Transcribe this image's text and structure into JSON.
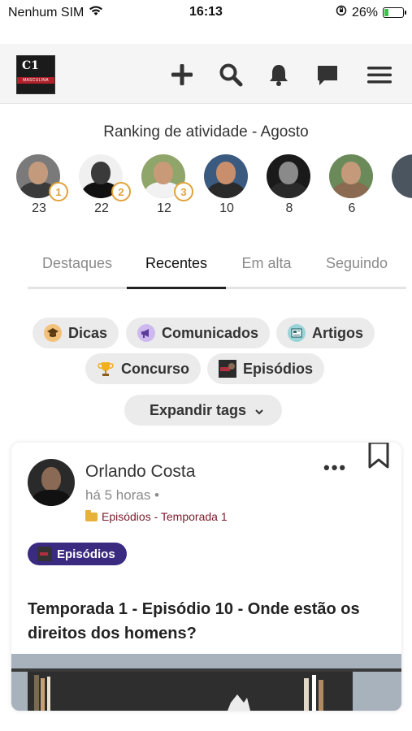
{
  "status_bar": {
    "carrier": "Nenhum SIM",
    "time": "16:13",
    "battery": "26%",
    "battery_level": 0.26
  },
  "app_header": {
    "logo_text": "MASCULINA",
    "icons": [
      "plus-icon",
      "search-icon",
      "bell-icon",
      "chat-icon",
      "menu-icon"
    ]
  },
  "ranking": {
    "title": "Ranking de atividade - Agosto",
    "users": [
      {
        "count": "23",
        "medal": "1",
        "medal_color": "#e0a23a",
        "bg": "#7a7a7a",
        "face": "#c49a7c",
        "body": "#3a3a3a"
      },
      {
        "count": "22",
        "medal": "2",
        "medal_color": "#e0a23a",
        "bg": "#f0f0f0",
        "face": "#3a3a3a",
        "body": "#111111"
      },
      {
        "count": "12",
        "medal": "3",
        "medal_color": "#e0a23a",
        "bg": "#8fa56a",
        "face": "#c89a78",
        "body": "#f2f2f2"
      },
      {
        "count": "10",
        "medal": "",
        "medal_color": "",
        "bg": "#3a5a80",
        "face": "#c98f6c",
        "body": "#2a2a2a"
      },
      {
        "count": "8",
        "medal": "",
        "medal_color": "",
        "bg": "#1a1a1a",
        "face": "#8a8a8a",
        "body": "#2a2a2a"
      },
      {
        "count": "6",
        "medal": "",
        "medal_color": "",
        "bg": "#6a8a5a",
        "face": "#c59a7a",
        "body": "#8a6a50"
      }
    ]
  },
  "tabs": {
    "items": [
      "Destaques",
      "Recentes",
      "Em alta",
      "Seguindo"
    ],
    "active": "Recentes"
  },
  "tags": {
    "items": [
      "Dicas",
      "Comunicados",
      "Artigos",
      "Concurso",
      "Episódios"
    ],
    "expand_label": "Expandir tags"
  },
  "post": {
    "author": "Orlando Costa",
    "time": "há 5 horas •",
    "category": "Episódios - Temporada 1",
    "badge": "Episódios",
    "title": "Temporada 1 - Episódio 10 - Onde estão os direitos dos homens?"
  },
  "colors": {
    "accent_purple": "#3a2a80",
    "category_text": "#7a1a2a",
    "medal_gold": "#e0a23a"
  }
}
